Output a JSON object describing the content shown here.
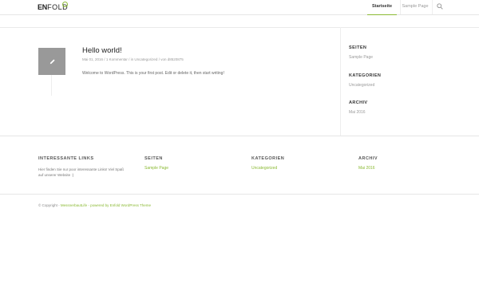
{
  "header": {
    "logo_en": "EN",
    "logo_fold": "FOLD",
    "nav": [
      {
        "label": "Startseite",
        "active": true
      },
      {
        "label": "Sample Page",
        "active": false
      }
    ],
    "search_icon": "search-icon"
  },
  "post": {
    "thumb_icon": "pencil-icon",
    "title": "Hello world!",
    "date": "Mai 01, 2016",
    "comments": "1 Kommentar",
    "category_prefix": "in",
    "category": "Uncategorized",
    "author_prefix": "von",
    "author": "d8520875",
    "excerpt": "Welcome to WordPress. This is your first post. Edit or delete it, then start writing!"
  },
  "sidebar": {
    "seiten_title": "SEITEN",
    "seiten_link": "Sample Page",
    "kategorien_title": "KATEGORIEN",
    "kategorien_link": "Uncategorized",
    "archiv_title": "ARCHIV",
    "archiv_link": "Mai 2016"
  },
  "footer": {
    "col1_title": "INTERESSANTE LINKS",
    "col1_text": "Hier finden Sie nur poor interessante Links! Viel Spaß auf unserer Website :)",
    "col2_title": "SEITEN",
    "col2_link": "Sample Page",
    "col3_title": "KATEGORIEN",
    "col3_link": "Uncategorized",
    "col4_title": "ARCHIV",
    "col4_link": "Mai 2016"
  },
  "socket": {
    "copyright_prefix": "© Copyright -",
    "site": "MessnerbautLife",
    "powered_prefix": "- powered by",
    "theme": "Enfold WordPress Theme"
  },
  "colors": {
    "accent": "#8bba34",
    "thumb": "#999999"
  }
}
